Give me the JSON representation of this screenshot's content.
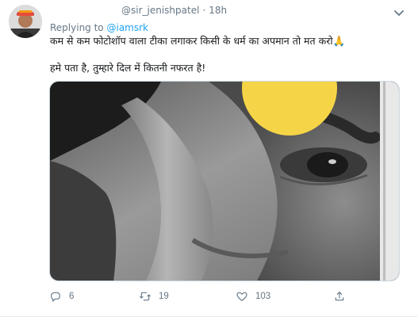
{
  "tweet": {
    "handle": "@sir_jenishpatel",
    "separator": "·",
    "time": "18h",
    "replying_prefix": "Replying to",
    "replying_to": "@iamsrk",
    "text_line1": "कम से कम फोटोशॉप वाला टीका लगाकर किसी के धर्म का अपमान तो मत करो🙏",
    "text_line2": "हमे पता है, तुम्हारे दिल में कितनी नफरत है!"
  },
  "actions": {
    "reply_count": "6",
    "retweet_count": "19",
    "like_count": "103",
    "share_count": ""
  },
  "colors": {
    "link": "#1da1f2",
    "secondary_text": "#657786",
    "highlight_circle": "#f6d447"
  },
  "icons": {
    "more": "chevron-down-icon",
    "reply": "reply-icon",
    "retweet": "retweet-icon",
    "like": "heart-icon",
    "share": "share-icon"
  }
}
